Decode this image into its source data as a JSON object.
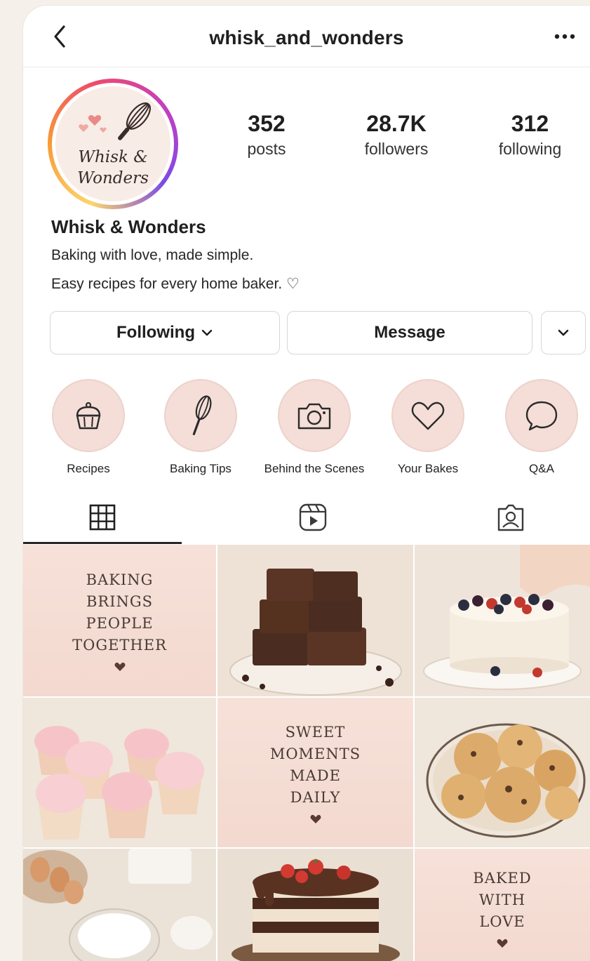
{
  "header": {
    "username": "whisk_and_wonders"
  },
  "avatar": {
    "logo_line1": "Whisk &",
    "logo_line2": "Wonders"
  },
  "stats": [
    {
      "value": "352",
      "label": "posts"
    },
    {
      "value": "28.7K",
      "label": "followers"
    },
    {
      "value": "312",
      "label": "following"
    }
  ],
  "profile": {
    "display_name": "Whisk & Wonders",
    "bio_line1": "Baking with love, made simple.",
    "bio_line2": "Easy recipes for every home baker. ♡"
  },
  "actions": {
    "following_label": "Following",
    "message_label": "Message"
  },
  "highlights": [
    {
      "label": "Recipes",
      "icon": "cupcake-icon"
    },
    {
      "label": "Baking Tips",
      "icon": "whisk-icon"
    },
    {
      "label": "Behind the Scenes",
      "icon": "camera-icon"
    },
    {
      "label": "Your Bakes",
      "icon": "heart-icon"
    },
    {
      "label": "Q&A",
      "icon": "chat-bubble-icon"
    }
  ],
  "tabs": [
    {
      "icon": "grid-icon",
      "active": true
    },
    {
      "icon": "reels-icon",
      "active": false
    },
    {
      "icon": "tagged-icon",
      "active": false
    }
  ],
  "posts": {
    "quote1": [
      "BAKING",
      "BRINGS",
      "PEOPLE",
      "TOGETHER"
    ],
    "quote2": [
      "SWEET",
      "MOMENTS",
      "MADE",
      "DAILY"
    ],
    "quote3": [
      "BAKED",
      "WITH",
      "LOVE"
    ]
  },
  "colors": {
    "accent_text": "#262626",
    "highlight_bg": "#f4ded7",
    "quote_bg": "#f6e1d8",
    "heart": "#5a3b33"
  }
}
